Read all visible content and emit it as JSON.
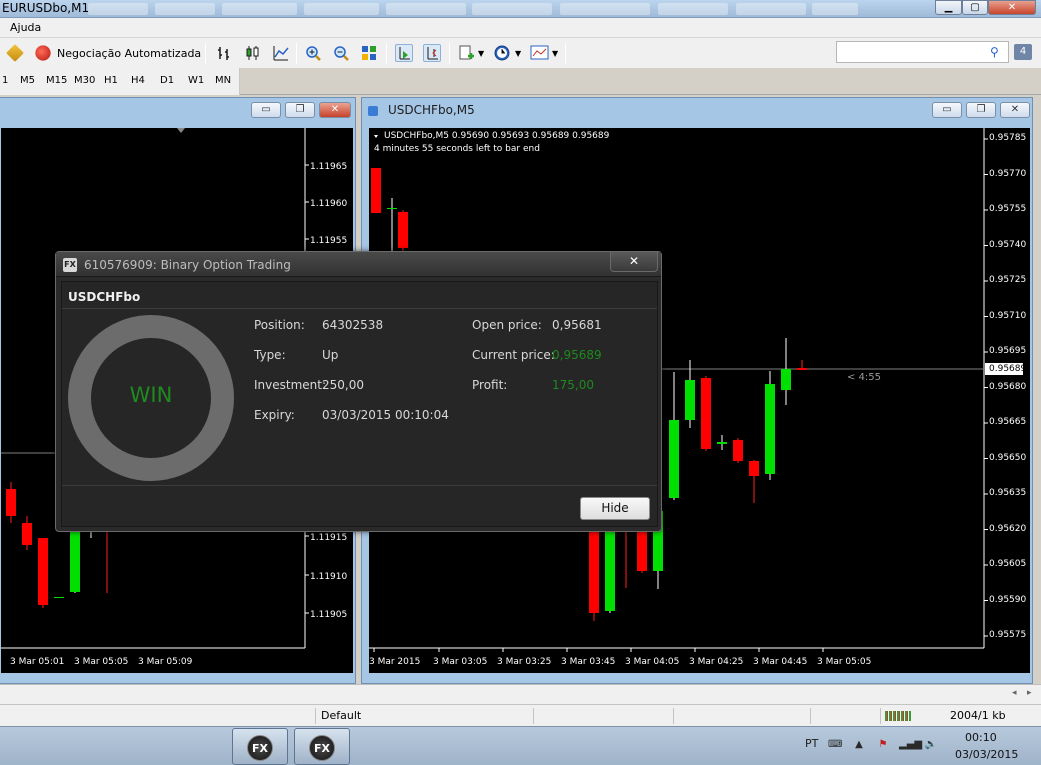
{
  "app": {
    "title": "EURUSDbo,M1"
  },
  "menu": {
    "items": [
      "Ajuda"
    ]
  },
  "toolbar": {
    "auto_trading_label": "Negociação Automatizada",
    "notification_count": "4",
    "icons": [
      "profile-icon",
      "auto-trading-icon",
      "bar-chart-icon",
      "candlestick-icon",
      "line-chart-icon",
      "zoom-in-icon",
      "zoom-out-icon",
      "tile-windows-icon",
      "chart-shift-icon",
      "autoscroll-icon",
      "new-order-icon",
      "periods-icon",
      "templates-icon",
      "search-icon"
    ]
  },
  "timeframes": [
    "1",
    "M5",
    "M15",
    "M30",
    "H1",
    "H4",
    "D1",
    "W1",
    "MN"
  ],
  "charts": {
    "left": {
      "price_labels": [
        "1.11965",
        "1.11960",
        "1.11955",
        "1.11915",
        "1.11910",
        "1.11905"
      ],
      "time_labels": [
        "3 Mar 05:01",
        "3 Mar 05:05",
        "3 Mar 05:09"
      ]
    },
    "right": {
      "title": "USDCHFbo,M5",
      "ohlc_text": "USDCHFbo,M5  0.95690 0.95693 0.95689 0.95689",
      "countdown_text": "4 minutes 55 seconds left to bar end",
      "price_labels": [
        "0.95785",
        "0.95770",
        "0.95755",
        "0.95740",
        "0.95725",
        "0.95710",
        "0.95695",
        "0.95680",
        "0.95665",
        "0.95650",
        "0.95635",
        "0.95620",
        "0.95605",
        "0.95590",
        "0.95575"
      ],
      "current_price_label": "0.95689",
      "bar_timer": "< 4:55",
      "time_labels": [
        "3 Mar 2015",
        "3 Mar 03:05",
        "3 Mar 03:25",
        "3 Mar 03:45",
        "3 Mar 04:05",
        "3 Mar 04:25",
        "3 Mar 04:45",
        "3 Mar 05:05"
      ]
    }
  },
  "dialog": {
    "title": "610576909: Binary Option Trading",
    "symbol": "USDCHFbo",
    "result": "WIN",
    "fields_left": [
      {
        "label": "Position:",
        "value": "64302538"
      },
      {
        "label": "Type:",
        "value": "Up"
      },
      {
        "label": "Investment:",
        "value": "250,00"
      },
      {
        "label": "Expiry:",
        "value": "03/03/2015 00:10:04"
      }
    ],
    "fields_right": [
      {
        "label": "Open price:",
        "value": "0,95681"
      },
      {
        "label": "Current price:",
        "value": "0,95689"
      },
      {
        "label": "Profit:",
        "value": "175,00"
      }
    ],
    "hide_label": "Hide",
    "colors": {
      "win": "#1e8a1e",
      "ring": "#6c6c6c"
    }
  },
  "statusbar": {
    "profile": "Default",
    "traffic": "2004/1 kb"
  },
  "taskbar": {
    "language": "PT",
    "time": "00:10",
    "date": "03/03/2015",
    "task_labels": [
      "FX",
      "FX"
    ]
  }
}
